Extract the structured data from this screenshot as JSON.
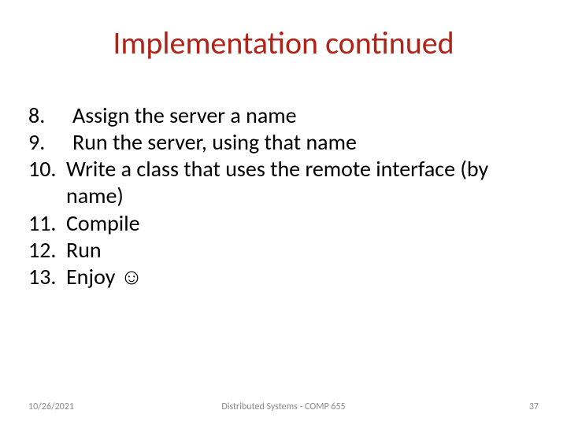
{
  "title": "Implementation continued",
  "items": [
    {
      "n": "8.",
      "text": "Assign the server a name",
      "tight": false
    },
    {
      "n": "9.",
      "text": "Run the server, using that name",
      "tight": false
    },
    {
      "n": "10.",
      "text": "Write a class that uses the remote interface (by name)",
      "tight": true
    },
    {
      "n": "11.",
      "text": "Compile",
      "tight": true
    },
    {
      "n": "12.",
      "text": "Run",
      "tight": true
    },
    {
      "n": "13.",
      "text": "Enjoy ☺",
      "tight": true
    }
  ],
  "footer": {
    "date": "10/26/2021",
    "center": "Distributed Systems - COMP 655",
    "page": "37"
  }
}
